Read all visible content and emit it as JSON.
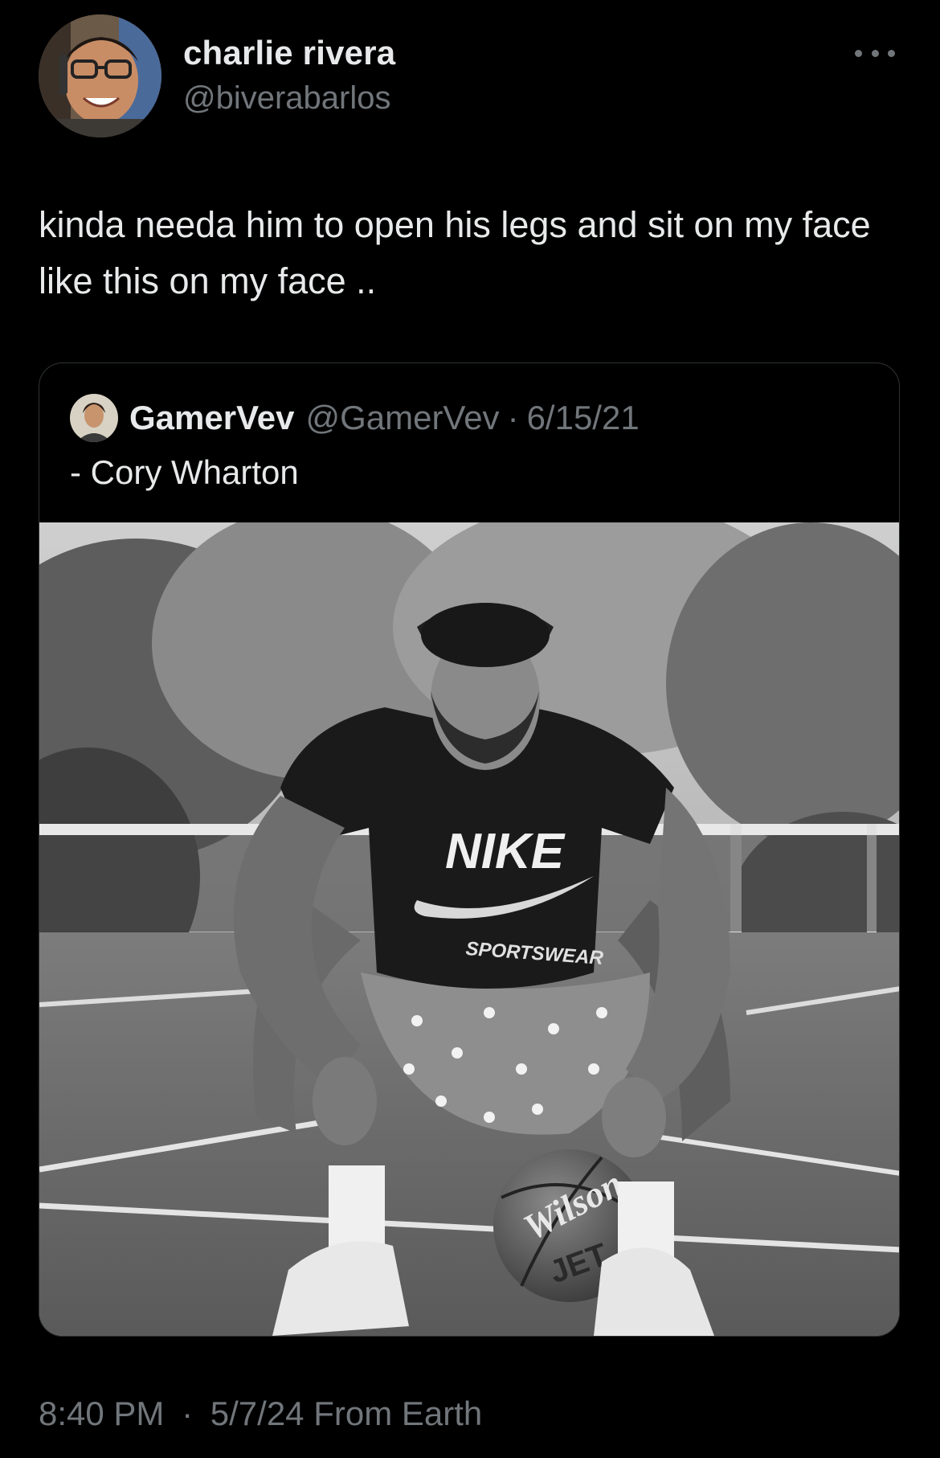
{
  "author": {
    "display_name": "charlie rivera",
    "handle": "@biverabarlos",
    "avatar_icon": "user-avatar-photo"
  },
  "tweet": {
    "text": "kinda needa him to open his legs and sit on my face like this on my face .."
  },
  "quoted_tweet": {
    "display_name": "GamerVev",
    "handle": "@GamerVev",
    "separator": "·",
    "date": "6/15/21",
    "text": "- Cory Wharton",
    "media": {
      "shirt_brand": "NIKE",
      "shirt_subtext": "SPORTSWEAR",
      "ball_brand": "Wilson",
      "ball_model": "JET"
    }
  },
  "footer": {
    "time": "8:40 PM",
    "separator": "·",
    "date": "5/7/24",
    "source": "From Earth"
  },
  "colors": {
    "background": "#000000",
    "text_primary": "#e7e9ea",
    "text_secondary": "#71767b",
    "border": "#2f3336"
  }
}
